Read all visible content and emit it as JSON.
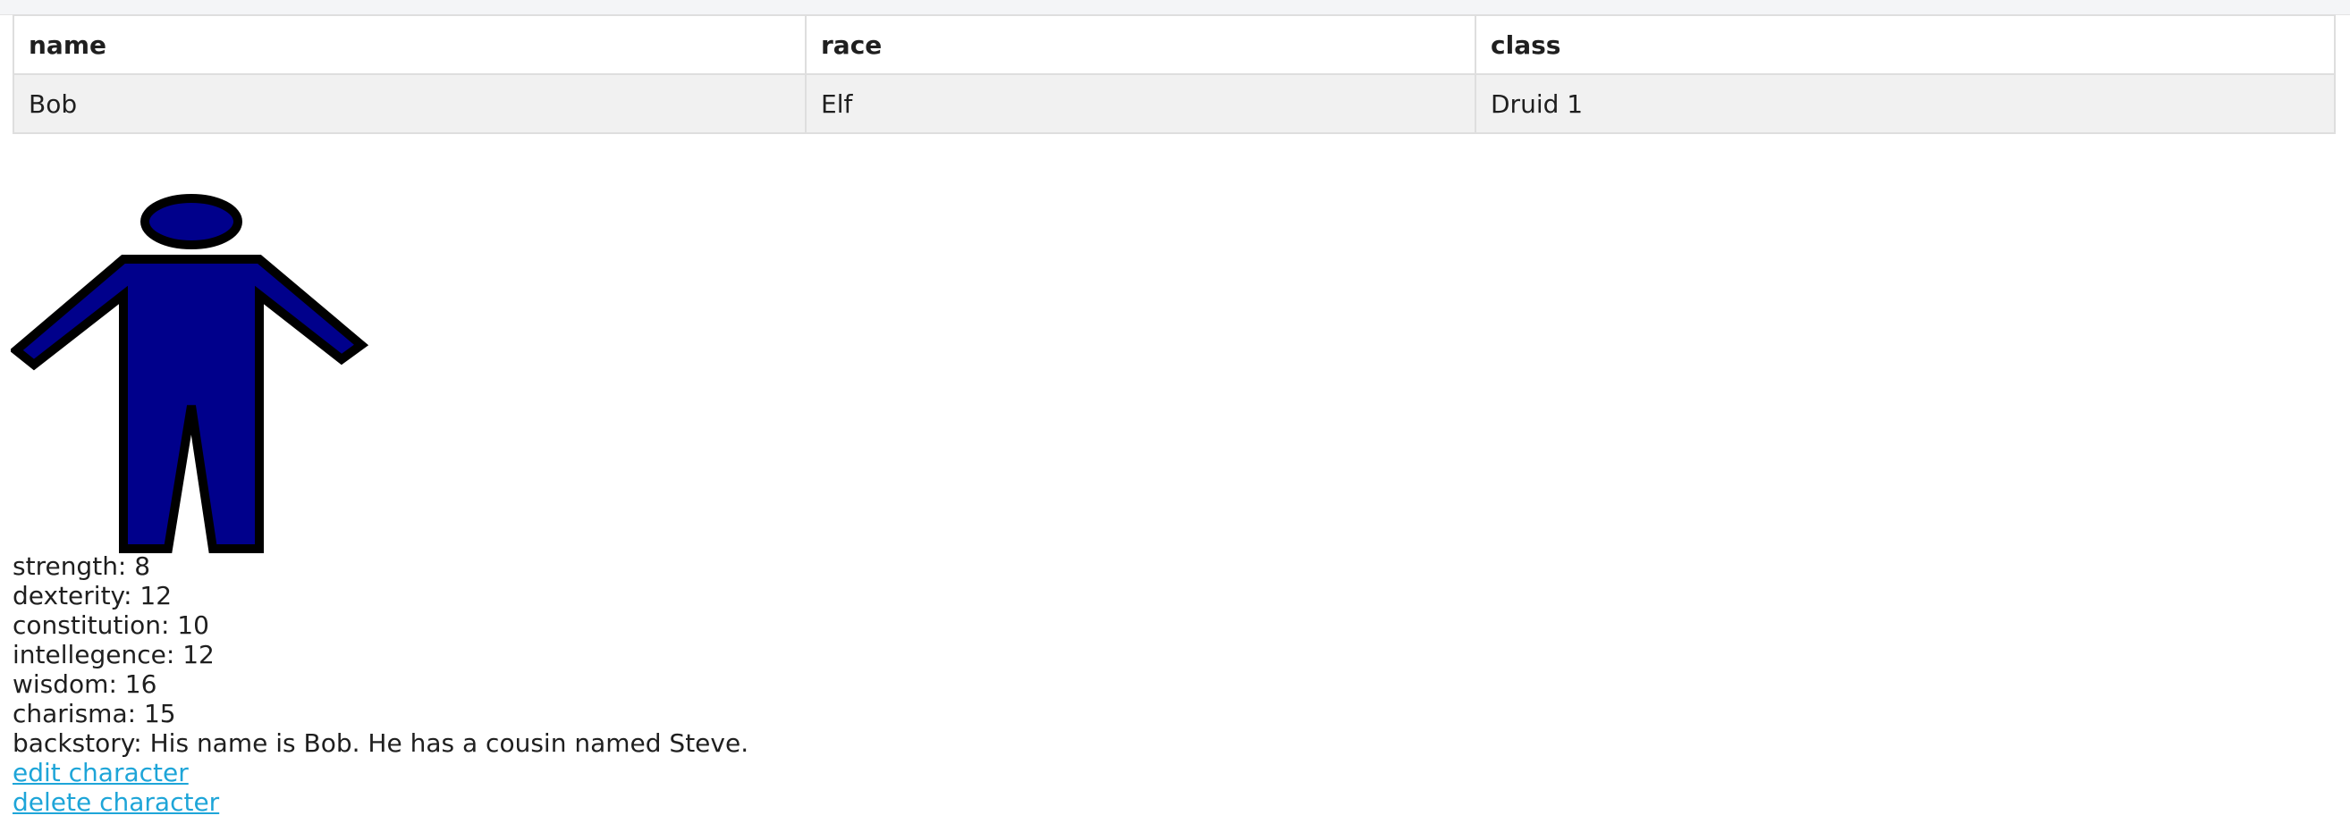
{
  "table": {
    "headers": [
      "name",
      "race",
      "class"
    ],
    "rows": [
      [
        "Bob",
        "Elf",
        "Druid 1"
      ]
    ]
  },
  "figure": {
    "icon": "person-figure-icon",
    "fill_color": "#00008b",
    "stroke_color": "#000000"
  },
  "stats": {
    "strength": "strength: 8",
    "dexterity": "dexterity: 12",
    "constitution": "constitution: 10",
    "intellegence": "intellegence: 12",
    "wisdom": "wisdom: 16",
    "charisma": "charisma: 15",
    "backstory": "backstory: His name is Bob. He has a cousin named Steve."
  },
  "links": {
    "edit": "edit character",
    "delete": "delete character"
  },
  "colors": {
    "link": "#1ea5d8",
    "row_bg": "#f1f1f1",
    "border": "#dedede"
  }
}
